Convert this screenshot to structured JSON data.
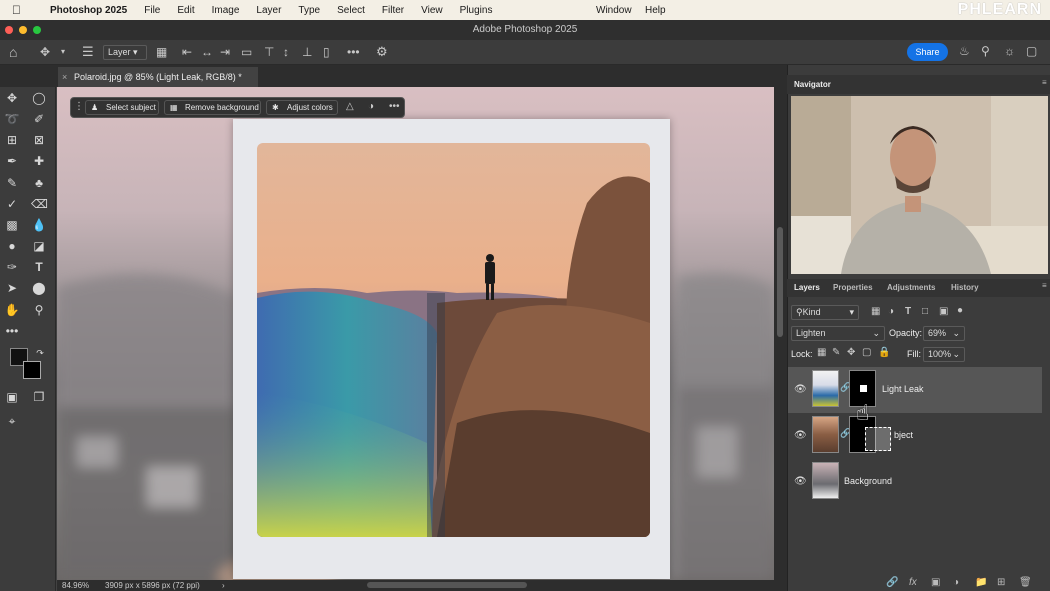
{
  "menubar": {
    "apple": "",
    "app_name": "Photoshop 2025",
    "items": [
      "File",
      "Edit",
      "Image",
      "Layer",
      "Type",
      "Select",
      "Filter",
      "View",
      "Plugins",
      "Window",
      "Help"
    ],
    "brand_logo": "PHLEARN"
  },
  "titlebar": {
    "title": "Adobe Photoshop 2025"
  },
  "options": {
    "layer_select": "Layer",
    "share_label": "Share",
    "more": "•••"
  },
  "document_tab": {
    "label": "Polaroid.jpg @ 85% (Light Leak, RGB/8) *",
    "close": "×"
  },
  "context_bar": {
    "select_subject": "Select subject",
    "remove_background": "Remove background",
    "adjust_colors": "Adjust colors",
    "more": "•••"
  },
  "toolbar": {
    "more": "•••"
  },
  "status": {
    "zoom": "84.96%",
    "dimensions": "3909 px x 5896 px (72 ppi)",
    "arrow": "›"
  },
  "navigator": {
    "tab": "Navigator"
  },
  "layers_panel": {
    "tabs": [
      "Layers",
      "Properties",
      "Adjustments",
      "History"
    ],
    "filter_kind": "Kind",
    "blend_mode": "Lighten",
    "opacity_label": "Opacity:",
    "opacity_value": "69%",
    "lock_label": "Lock:",
    "fill_label": "Fill:",
    "fill_value": "100%",
    "layers": [
      {
        "name": "Light Leak",
        "visible": true,
        "selected": true
      },
      {
        "name": "bject",
        "visible": true,
        "selected": false
      },
      {
        "name": "Background",
        "visible": true,
        "selected": false
      }
    ],
    "footer_fx": "fx"
  },
  "colors": {
    "accent": "#1473e6",
    "panel": "#3c3c3c",
    "selected_layer": "#565656"
  }
}
